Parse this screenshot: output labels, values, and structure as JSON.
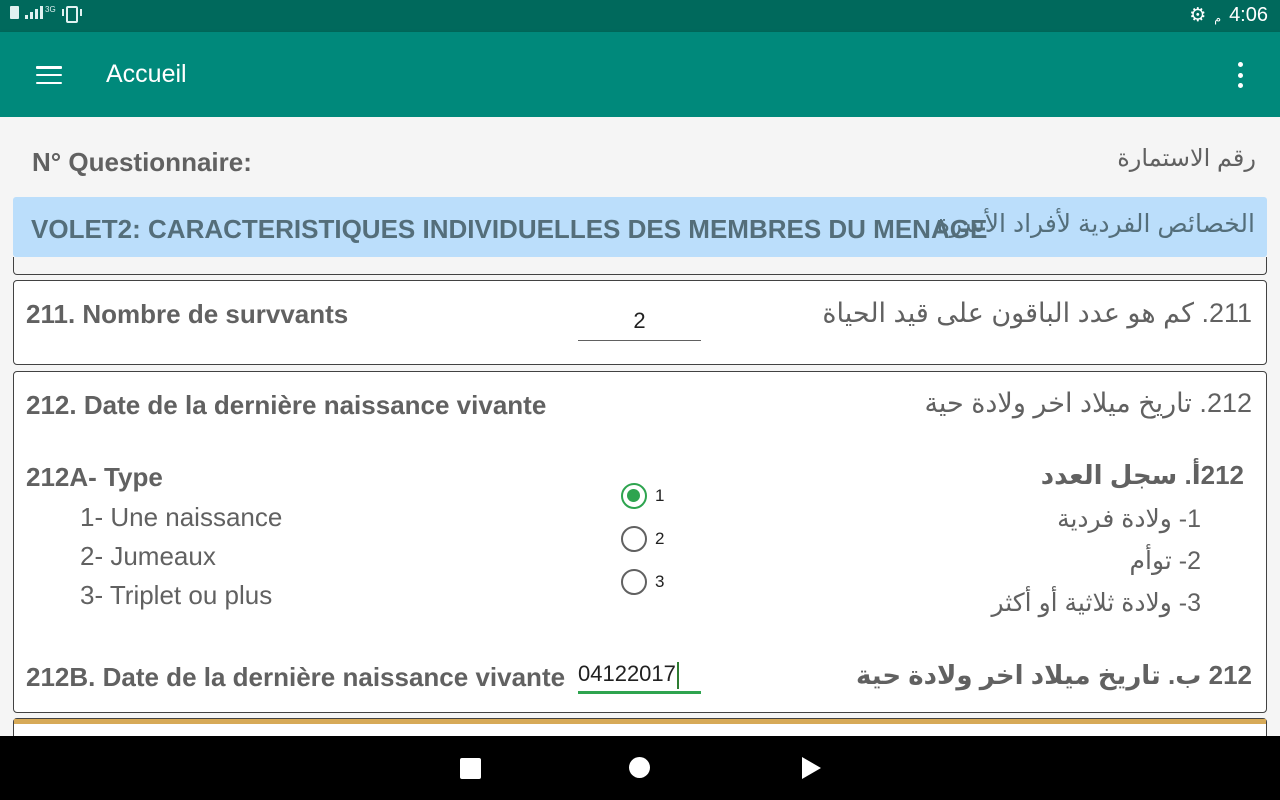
{
  "status_bar": {
    "network_label": "3G",
    "ampm": "م",
    "time": "4:06",
    "icons": [
      "sim-card-icon",
      "signal-icon",
      "vibrate-icon",
      "settings-gear-icon"
    ]
  },
  "toolbar": {
    "title": "Accueil",
    "menu_icon": "hamburger-menu-icon",
    "overflow_icon": "more-vert-icon",
    "color": "#00897b"
  },
  "questionnaire": {
    "label_fr": "N° Questionnaire:",
    "label_ar": "رقم الاستمارة"
  },
  "section": {
    "title_fr": "VOLET2: CARACTERISTIQUES INDIVIDUELLES DES MEMBRES DU MENAGE",
    "title_ar": "الخصائص الفردية لأفراد الأسرة",
    "color": "#bbdefb"
  },
  "q211": {
    "label_fr": "211. Nombre de survvants",
    "label_ar": "211. كم هو عدد الباقون على قيد الحياة",
    "value": "2"
  },
  "q212": {
    "label_fr": "212. Date de la dernière naissance vivante",
    "label_ar": "212. تاريخ ميلاد اخر ولادة حية"
  },
  "q212a": {
    "label_fr": "212A- Type",
    "label_ar": "212أ. سجل العدد",
    "options_fr": [
      "1- Une naissance",
      "2- Jumeaux",
      "3- Triplet ou plus"
    ],
    "options_ar": [
      "1- ولادة فردية",
      "2- توأم",
      "3- ولادة ثلاثية أو أكثر"
    ],
    "radios": [
      "1",
      "2",
      "3"
    ],
    "selected": "1",
    "accent": "#2ea44f"
  },
  "q212b": {
    "label_fr": "212B. Date de la dernière naissance vivante",
    "label_ar": "212 ب. تاريخ ميلاد اخر ولادة حية",
    "value": "04122017"
  },
  "nav_bar": {
    "icons": [
      "back-square-icon",
      "home-circle-icon",
      "recents-triangle-icon"
    ]
  }
}
